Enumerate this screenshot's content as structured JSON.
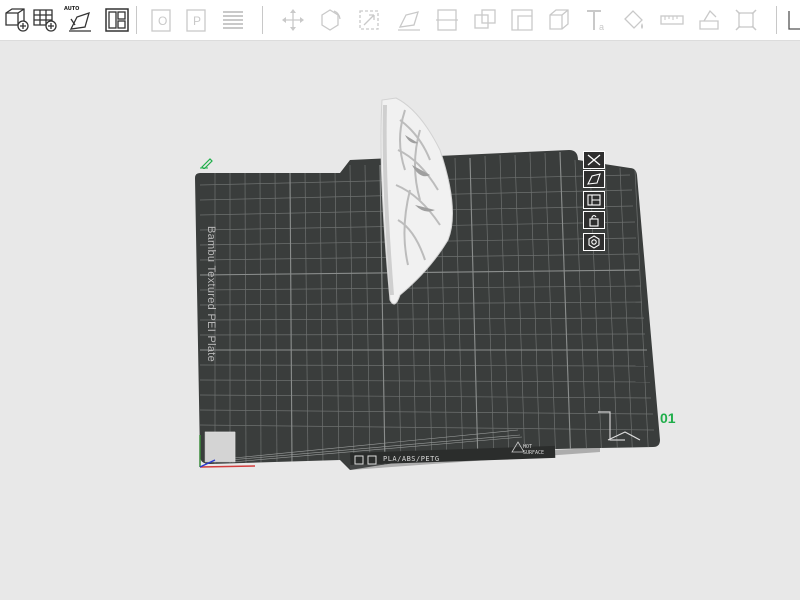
{
  "toolbar": {
    "items": [
      {
        "name": "add-object",
        "icon": "cube-plus-icon"
      },
      {
        "name": "add-plate",
        "icon": "grid-plus-icon"
      },
      {
        "name": "auto-orient",
        "icon": "auto-orient-icon",
        "label": "AUTO"
      },
      {
        "name": "arrange",
        "icon": "arrange-icon"
      },
      {
        "name": "split-objects",
        "icon": "split-objects-icon"
      },
      {
        "name": "split-parts",
        "icon": "split-parts-icon"
      },
      {
        "name": "variable-layer-height",
        "icon": "layers-icon"
      },
      {
        "name": "move",
        "icon": "move-icon"
      },
      {
        "name": "rotate",
        "icon": "rotate-icon"
      },
      {
        "name": "scale",
        "icon": "scale-icon"
      },
      {
        "name": "lay-on-face",
        "icon": "lay-on-face-icon"
      },
      {
        "name": "cut",
        "icon": "cut-icon"
      },
      {
        "name": "boolean",
        "icon": "boolean-icon"
      },
      {
        "name": "measure",
        "icon": "measure-icon"
      },
      {
        "name": "assembly",
        "icon": "assembly-icon"
      },
      {
        "name": "text",
        "icon": "text-icon"
      },
      {
        "name": "paint",
        "icon": "paint-bucket-icon"
      },
      {
        "name": "ruler",
        "icon": "ruler-icon"
      },
      {
        "name": "support-paint",
        "icon": "support-paint-icon"
      },
      {
        "name": "seam-paint",
        "icon": "seam-icon"
      },
      {
        "name": "view",
        "icon": "view-icon"
      }
    ]
  },
  "plate": {
    "name": "Bambu Textured PEI Plate",
    "number": "01",
    "filaments": "PLA/ABS/PETG",
    "surface_line1": "HOT",
    "surface_line2": "SURFACE"
  },
  "plate_tools": [
    {
      "name": "delete-plate",
      "icon": "close-icon"
    },
    {
      "name": "orient-plate",
      "icon": "orient-icon"
    },
    {
      "name": "arrange-plate",
      "icon": "arrange-icon"
    },
    {
      "name": "lock-plate",
      "icon": "lock-icon"
    },
    {
      "name": "plate-settings",
      "icon": "gear-icon"
    }
  ],
  "colors": {
    "plate_bg": "#3a3d3c",
    "grid": "#6e7170",
    "plate_number": "#1fae4a",
    "model": "#f2f2f2",
    "viewport": "#e8e8e8"
  }
}
